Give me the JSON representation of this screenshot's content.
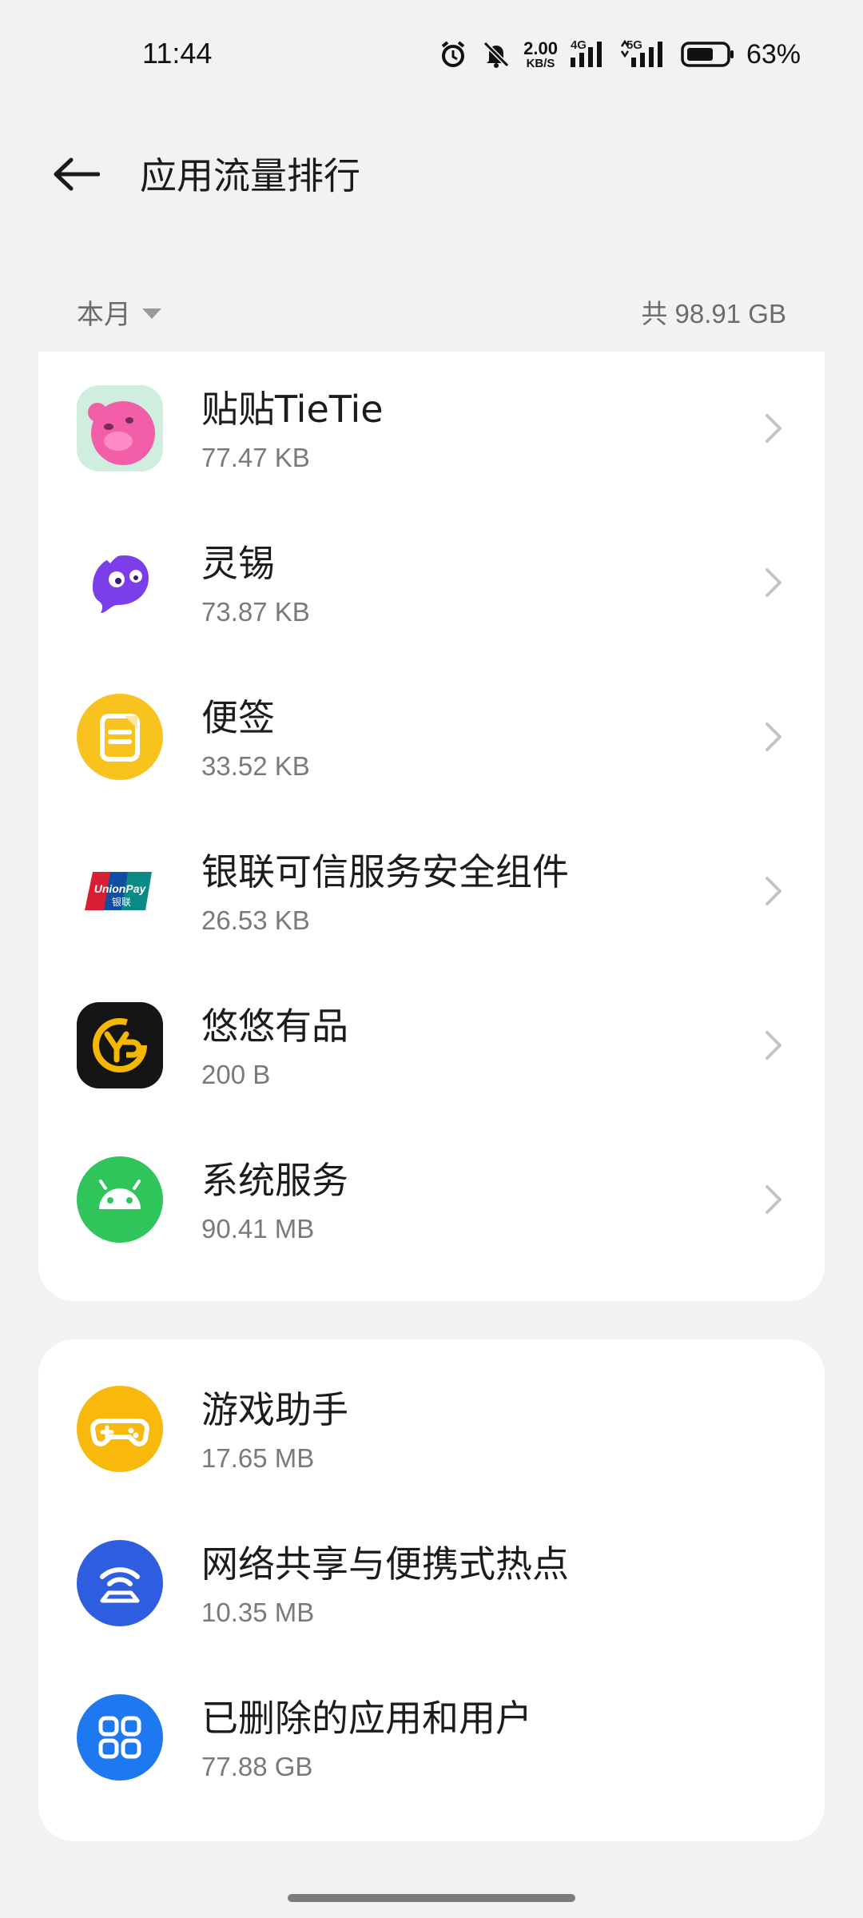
{
  "status_bar": {
    "time": "11:44",
    "net_speed_value": "2.00",
    "net_speed_unit": "KB/S",
    "signal1_label": "4G",
    "signal2_label": "5G",
    "battery_percent": "63%",
    "icons": [
      "alarm-icon",
      "silent-bell-icon",
      "signal-icon",
      "battery-icon"
    ]
  },
  "header": {
    "title": "应用流量排行",
    "back_icon": "arrow-left-icon"
  },
  "filter": {
    "period": "本月",
    "total": "共 98.91 GB"
  },
  "app_list": [
    {
      "name": "贴贴TieTie",
      "usage": "77.47 KB",
      "icon": "tietie-pink-bear-icon"
    },
    {
      "name": "灵锡",
      "usage": "73.87 KB",
      "icon": "lingxi-purple-icon"
    },
    {
      "name": "便签",
      "usage": "33.52 KB",
      "icon": "notes-yellow-icon"
    },
    {
      "name": "银联可信服务安全组件",
      "usage": "26.53 KB",
      "icon": "unionpay-icon"
    },
    {
      "name": "悠悠有品",
      "usage": "200 B",
      "icon": "youyou-icon"
    },
    {
      "name": "系统服务",
      "usage": "90.41 MB",
      "icon": "android-icon"
    }
  ],
  "system_list": [
    {
      "name": "游戏助手",
      "usage": "17.65 MB",
      "icon": "gamepad-icon"
    },
    {
      "name": "网络共享与便携式热点",
      "usage": "10.35 MB",
      "icon": "hotspot-icon"
    },
    {
      "name": "已删除的应用和用户",
      "usage": "77.88 GB",
      "icon": "apps-grid-icon"
    }
  ],
  "unionpay_icon_text": [
    "UnionPay",
    "银联"
  ],
  "colors": {
    "background": "#f2f2f2",
    "card": "#ffffff",
    "android_green": "#2fc55a",
    "game_yellow": "#f8b90c",
    "hotspot_blue": "#2f5de0",
    "deleted_blue": "#1e78f0"
  }
}
